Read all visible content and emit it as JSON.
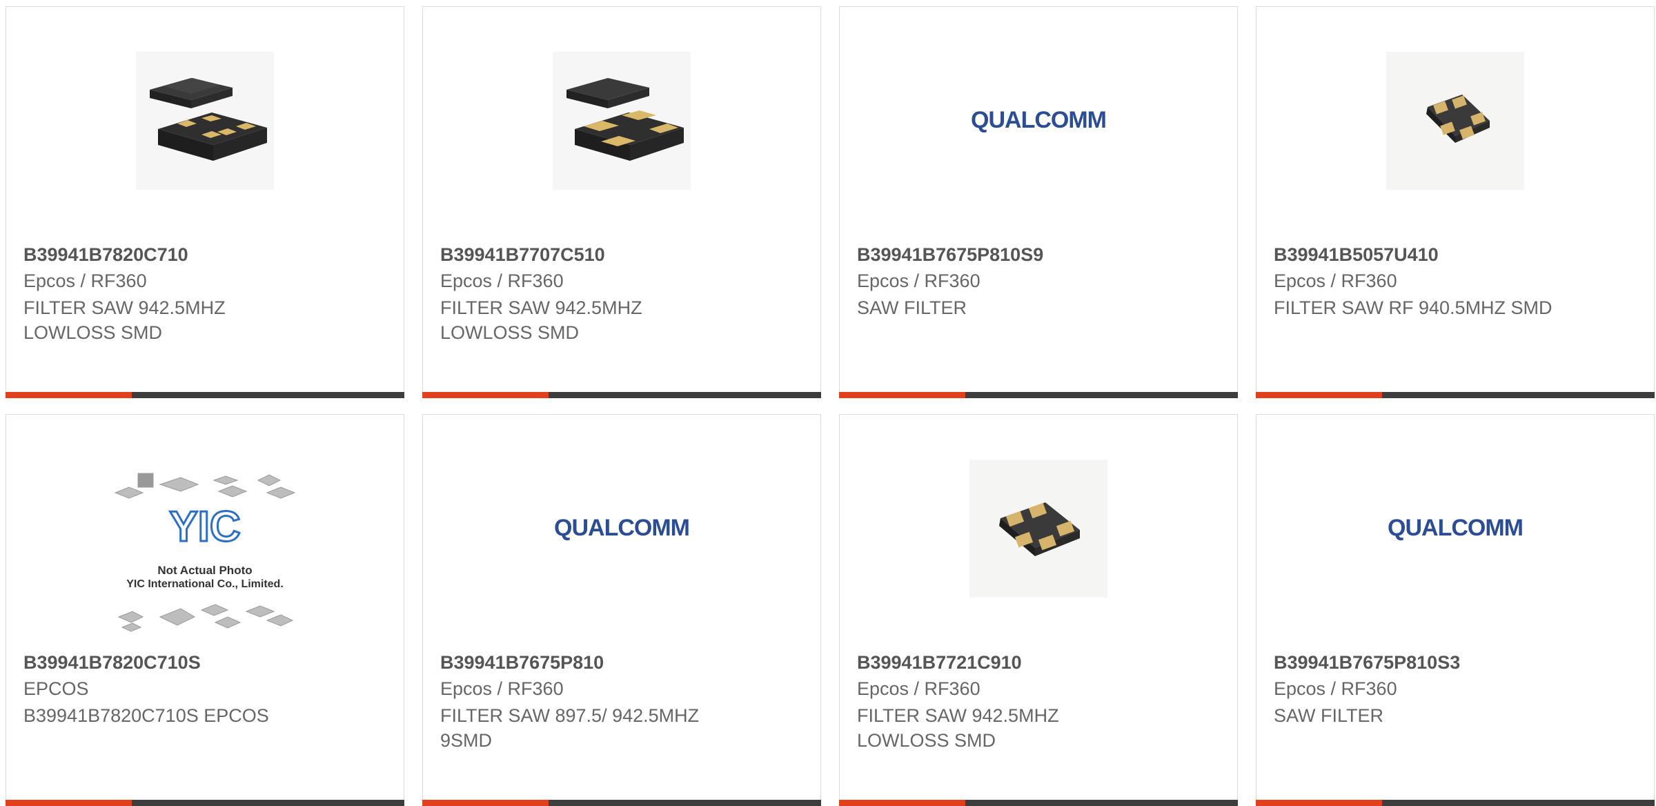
{
  "accent_color": "#e2401c",
  "products": [
    {
      "part": "B39941B7820C710",
      "mfr": "Epcos / RF360",
      "desc": "FILTER SAW 942.5MHZ LOWLOSS SMD",
      "image": "saw-package-open-icon"
    },
    {
      "part": "B39941B7707C510",
      "mfr": "Epcos / RF360",
      "desc": "FILTER SAW 942.5MHZ LOWLOSS SMD",
      "image": "saw-package-open-icon"
    },
    {
      "part": "B39941B7675P810S9",
      "mfr": "Epcos / RF360",
      "desc": "SAW FILTER",
      "image": "qualcomm-logo"
    },
    {
      "part": "B39941B5057U410",
      "mfr": "Epcos / RF360",
      "desc": "FILTER SAW RF 940.5MHZ SMD",
      "image": "smd-chip-icon"
    },
    {
      "part": "B39941B7820C710S",
      "mfr": "EPCOS",
      "desc": "B39941B7820C710S EPCOS",
      "image": "yic-placeholder",
      "placeholder": {
        "brand": "YIC",
        "line1": "Not Actual Photo",
        "line2": "YIC International Co., Limited."
      }
    },
    {
      "part": "B39941B7675P810",
      "mfr": "Epcos / RF360",
      "desc": "FILTER SAW 897.5/ 942.5MHZ 9SMD",
      "image": "qualcomm-logo"
    },
    {
      "part": "B39941B7721C910",
      "mfr": "Epcos / RF360",
      "desc": "FILTER SAW 942.5MHZ LOWLOSS SMD",
      "image": "smd-chip-icon"
    },
    {
      "part": "B39941B7675P810S3",
      "mfr": "Epcos / RF360",
      "desc": "SAW FILTER",
      "image": "qualcomm-logo"
    }
  ],
  "logo_text": "QUALCOMM"
}
